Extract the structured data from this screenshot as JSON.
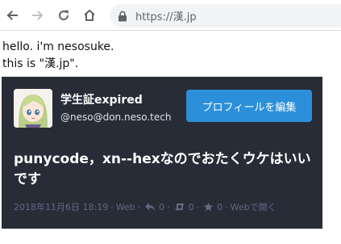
{
  "browser": {
    "url": "https://漢.jp",
    "icons": [
      "back-arrow-icon",
      "forward-arrow-icon",
      "reload-icon",
      "home-icon",
      "lock-icon"
    ]
  },
  "page": {
    "line1": "hello. i'm nesosuke.",
    "line2": "this is \"漢.jp\"."
  },
  "status": {
    "display_name": "学生証expired",
    "acct": "@neso@don.neso.tech",
    "profile_button": "プロフィールを編集",
    "content": "punycode，xn--hexなのでおたくウケはいいです",
    "date": "2018年11月6日 18:19",
    "sep1": "·",
    "visibility": "Web",
    "sep2": "·",
    "replies": "0",
    "sep3": "·",
    "reblogs": "0",
    "sep4": "·",
    "favourites": "0",
    "sep5": "·",
    "open_link": "Webで開く",
    "colors": {
      "card_bg": "#282c37",
      "button_bg": "#2b90d9",
      "meta_text": "#606984"
    }
  }
}
